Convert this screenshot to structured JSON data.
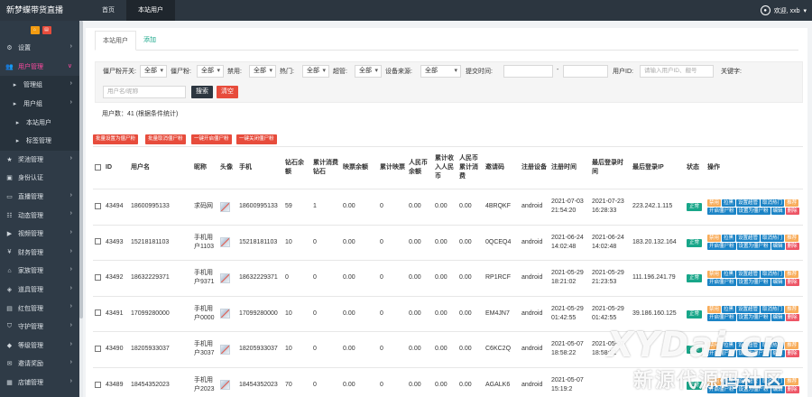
{
  "app": {
    "title": "新梦蝶带货直播",
    "nav": [
      "首页",
      "本站用户"
    ],
    "user_label": "欢迎, xxb",
    "user_icon": "user-circle-icon"
  },
  "sidebar": {
    "items": [
      {
        "label": "设置",
        "icon": "gear-icon",
        "glyph": "⚙"
      },
      {
        "label": "用户管理",
        "icon": "users-icon",
        "glyph": "👥"
      },
      {
        "label": "管理组",
        "icon": "caret-right-icon",
        "glyph": "▸"
      },
      {
        "label": "用户组",
        "icon": "caret-right-icon",
        "glyph": "▸"
      },
      {
        "label": "本站用户",
        "icon": "caret-right-icon",
        "glyph": "▸"
      },
      {
        "label": "标签管理",
        "icon": "caret-right-icon",
        "glyph": "▸"
      },
      {
        "label": "奖池管理",
        "icon": "trophy-icon",
        "glyph": "★"
      },
      {
        "label": "身份认证",
        "icon": "id-card-icon",
        "glyph": "▣"
      },
      {
        "label": "直播管理",
        "icon": "tv-icon",
        "glyph": "▭"
      },
      {
        "label": "动态管理",
        "icon": "feed-icon",
        "glyph": "☷"
      },
      {
        "label": "视频管理",
        "icon": "video-icon",
        "glyph": "▶"
      },
      {
        "label": "财务管理",
        "icon": "money-icon",
        "glyph": "¥"
      },
      {
        "label": "家族管理",
        "icon": "home-icon",
        "glyph": "⌂"
      },
      {
        "label": "道具管理",
        "icon": "box-icon",
        "glyph": "◈"
      },
      {
        "label": "红包管理",
        "icon": "gift-icon",
        "glyph": "▤"
      },
      {
        "label": "守护管理",
        "icon": "shield-icon",
        "glyph": "⛉"
      },
      {
        "label": "等级管理",
        "icon": "level-icon",
        "glyph": "◆"
      },
      {
        "label": "邀请奖励",
        "icon": "invite-icon",
        "glyph": "✉"
      },
      {
        "label": "店铺管理",
        "icon": "shop-icon",
        "glyph": "▦"
      }
    ]
  },
  "tabs": [
    "本站用户",
    "添加"
  ],
  "filters": {
    "zombie_switch": {
      "label": "僵尸粉开关:",
      "value": "全部"
    },
    "zombie_fans": {
      "label": "僵尸粉:",
      "value": "全部"
    },
    "banned": {
      "label": "禁用:",
      "value": "全部"
    },
    "hot": {
      "label": "热门:",
      "value": "全部"
    },
    "super": {
      "label": "超管:",
      "value": "全部"
    },
    "device_source": {
      "label": "设备来源:",
      "value": "全部"
    },
    "submit_time_label": "提交时间:",
    "date_separator": "-",
    "user_id_label": "用户ID:",
    "user_id_placeholder": "请输入用户ID、靓号",
    "keyword_label": "关键字:",
    "keyword_placeholder": "用户名/昵称",
    "search_label": "搜索",
    "clear_label": "清空"
  },
  "count_text": "用户数：41 (根据条件统计)",
  "bulk_actions": [
    "批量设置为僵尸粉",
    "批量取消僵尸粉",
    "一键开启僵尸粉",
    "一键关闭僵尸粉"
  ],
  "table": {
    "headers": [
      "ID",
      "用户名",
      "昵称",
      "头像",
      "手机",
      "钻石余额",
      "累计消费钻石",
      "映票余额",
      "累计映票",
      "人民币余额",
      "累计收入人民币",
      "人民币累计消费",
      "邀请码",
      "注册设备",
      "注册时间",
      "最后登录时间",
      "最后登录IP",
      "状态",
      "操作"
    ],
    "status_label": "正常",
    "ops": [
      "禁用",
      "拉黑",
      "设置超管",
      "取消热门",
      "推荐",
      "开启僵尸粉",
      "设置为僵尸粉",
      "编辑",
      "删除"
    ],
    "rows": [
      {
        "id": "43494",
        "username": "18600995133",
        "nickname": "求码网",
        "phone": "18600995133",
        "diamond": "59",
        "diamond_spent": "1",
        "votes": "0.00",
        "votes_total": "0",
        "rmb": "0.00",
        "rmb_income": "0.00",
        "rmb_spent": "0.00",
        "invite": "4BRQKF",
        "device": "android",
        "reg_time": "2021-07-03 21:54:20",
        "last_login": "2021-07-23 16:28:33",
        "ip": "223.242.1.115"
      },
      {
        "id": "43493",
        "username": "15218181103",
        "nickname": "手机用户1103",
        "phone": "15218181103",
        "diamond": "10",
        "diamond_spent": "0",
        "votes": "0.00",
        "votes_total": "0",
        "rmb": "0.00",
        "rmb_income": "0.00",
        "rmb_spent": "0.00",
        "invite": "0QCEQ4",
        "device": "android",
        "reg_time": "2021-06-24 14:02:48",
        "last_login": "2021-06-24 14:02:48",
        "ip": "183.20.132.164"
      },
      {
        "id": "43492",
        "username": "18632229371",
        "nickname": "手机用户9371",
        "phone": "18632229371",
        "diamond": "0",
        "diamond_spent": "0",
        "votes": "0.00",
        "votes_total": "0",
        "rmb": "0.00",
        "rmb_income": "0.00",
        "rmb_spent": "0.00",
        "invite": "RP1RCF",
        "device": "android",
        "reg_time": "2021-05-29 18:21:02",
        "last_login": "2021-05-29 21:23:53",
        "ip": "111.196.241.79"
      },
      {
        "id": "43491",
        "username": "17099280000",
        "nickname": "手机用户0000",
        "phone": "17099280000",
        "diamond": "10",
        "diamond_spent": "0",
        "votes": "0.00",
        "votes_total": "0",
        "rmb": "0.00",
        "rmb_income": "0.00",
        "rmb_spent": "0.00",
        "invite": "EM4JN7",
        "device": "android",
        "reg_time": "2021-05-29 01:42:55",
        "last_login": "2021-05-29 01:42:55",
        "ip": "39.186.160.125"
      },
      {
        "id": "43490",
        "username": "18205933037",
        "nickname": "手机用户3037",
        "phone": "18205933037",
        "diamond": "10",
        "diamond_spent": "0",
        "votes": "0.00",
        "votes_total": "0",
        "rmb": "0.00",
        "rmb_income": "0.00",
        "rmb_spent": "0.00",
        "invite": "C6KC2Q",
        "device": "android",
        "reg_time": "2021-05-07 18:58:22",
        "last_login": "2021-05-07 18:58:22",
        "ip": ""
      },
      {
        "id": "43489",
        "username": "18454352023",
        "nickname": "手机用户2023",
        "phone": "18454352023",
        "diamond": "70",
        "diamond_spent": "0",
        "votes": "0.00",
        "votes_total": "0",
        "rmb": "0.00",
        "rmb_income": "0.00",
        "rmb_spent": "0.00",
        "invite": "AGALK6",
        "device": "android",
        "reg_time": "2021-05-07 15:19:2",
        "last_login": "",
        "ip": ""
      }
    ]
  },
  "watermark": {
    "line1": "XYDai.cn",
    "line2": "新源代源码社区"
  },
  "colors": {
    "topbar": "#2c3640",
    "sidebar": "#2f3b47",
    "accent_pink": "#ff4aa0",
    "green": "#18a689",
    "red": "#e74c3c",
    "blue": "#1c84c6"
  }
}
